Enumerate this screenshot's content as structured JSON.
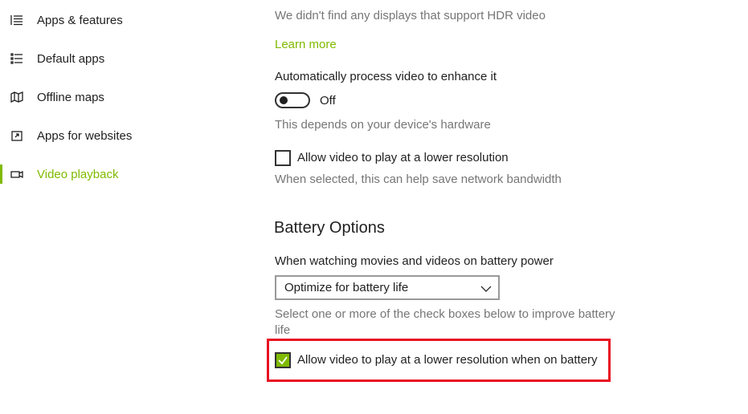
{
  "sidebar": {
    "items": [
      {
        "label": "Apps & features",
        "icon": "apps-features-icon"
      },
      {
        "label": "Default apps",
        "icon": "default-apps-icon"
      },
      {
        "label": "Offline maps",
        "icon": "offline-maps-icon"
      },
      {
        "label": "Apps for websites",
        "icon": "apps-for-websites-icon"
      },
      {
        "label": "Video playback",
        "icon": "video-playback-icon",
        "active": true
      }
    ]
  },
  "hdr": {
    "message": "We didn't find any displays that support HDR video",
    "learn_more": "Learn more"
  },
  "auto_process": {
    "heading": "Automatically process video to enhance it",
    "toggle_state": "Off",
    "note": "This depends on your device's hardware"
  },
  "lower_resolution": {
    "label": "Allow video to play at a lower resolution",
    "checked": false,
    "note": "When selected, this can help save network bandwidth"
  },
  "battery": {
    "title": "Battery Options",
    "dropdown_label": "When watching movies and videos on battery power",
    "dropdown_value": "Optimize for battery life",
    "help_line1": "Select one or more of the check boxes below to improve battery",
    "help_line2": "life",
    "battery_checkbox_label": "Allow video to play at a lower resolution when on battery",
    "battery_checkbox_checked": true
  },
  "colors": {
    "accent": "#7fba00",
    "highlight": "#e81123"
  }
}
